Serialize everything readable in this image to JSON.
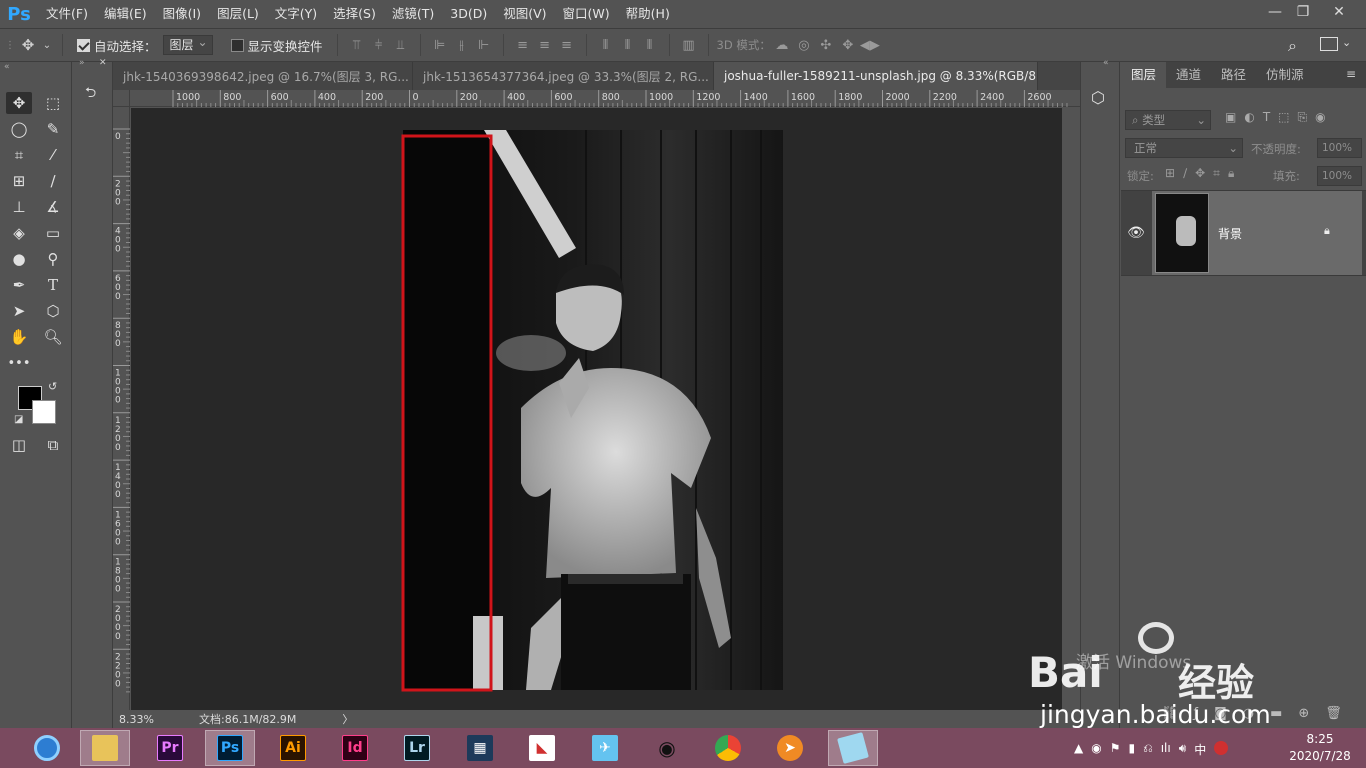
{
  "app": {
    "logo": "Ps"
  },
  "menu": [
    "文件(F)",
    "编辑(E)",
    "图像(I)",
    "图层(L)",
    "文字(Y)",
    "选择(S)",
    "滤镜(T)",
    "3D(D)",
    "视图(V)",
    "窗口(W)",
    "帮助(H)"
  ],
  "options": {
    "auto_select_label": "自动选择：",
    "auto_select_checked": true,
    "auto_select_target": "图层",
    "show_transform_label": "显示变换控件",
    "show_transform_checked": false,
    "mode3d_label": "3D 模式："
  },
  "tabs": [
    {
      "label": "jhk-1540369398642.jpeg @ 16.7%(图层 3, RG...",
      "active": false
    },
    {
      "label": "jhk-1513654377364.jpeg @ 33.3%(图层 2, RG...",
      "active": false
    },
    {
      "label": "joshua-fuller-1589211-unsplash.jpg @ 8.33%(RGB/8)",
      "active": true
    }
  ],
  "ruler_h": [
    "1000",
    "800",
    "600",
    "400",
    "200",
    "0",
    "200",
    "400",
    "600",
    "800",
    "1000",
    "1200",
    "1400",
    "1600",
    "1800",
    "2000",
    "2200",
    "2400",
    "2600"
  ],
  "ruler_v": [
    "0",
    "2\n0\n0",
    "4\n0\n0",
    "6\n0\n0",
    "8\n0\n0",
    "1\n0\n0\n0",
    "1\n2\n0\n0",
    "1\n4\n0\n0",
    "1\n6\n0\n0",
    "1\n8\n0\n0",
    "2\n0\n0\n0",
    "2\n2\n0\n0"
  ],
  "status": {
    "zoom": "8.33%",
    "doc": "文档:86.1M/82.9M",
    "arrow": "〉"
  },
  "panel": {
    "tabs": [
      "图层",
      "通道",
      "路径",
      "仿制源"
    ],
    "filter_label": "类型",
    "blend_mode": "正常",
    "opacity_label": "不透明度:",
    "opacity_value": "100%",
    "lock_label": "锁定:",
    "fill_label": "填充:",
    "fill_value": "100%",
    "layer_name": "背景"
  },
  "watermark": {
    "activate": "激活 Windows",
    "baidu": "Bai",
    "jingyan": "经验",
    "url": "jingyan.baidu.com"
  },
  "taskbar": {
    "apps": [
      "browser",
      "explorer",
      "Pr",
      "Ps",
      "Ai",
      "Id",
      "Lr",
      "video",
      "wps",
      "bird",
      "qq",
      "chrome",
      "fox",
      "notepad"
    ],
    "ime": "中",
    "time": "8:25",
    "date": "2020/7/28"
  },
  "colors": {
    "accent_ps": "#31a8ff",
    "selection": "#d0141a",
    "taskbar": "#7a4a5f"
  }
}
